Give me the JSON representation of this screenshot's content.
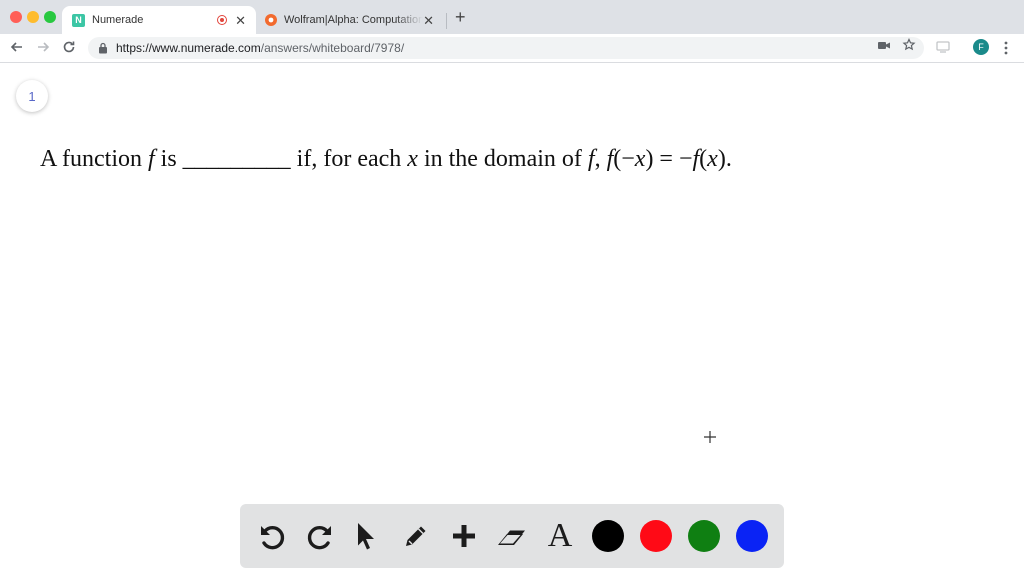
{
  "browser": {
    "tabs": [
      {
        "title": "Numerade",
        "favicon": "numerade-favicon",
        "active": true
      },
      {
        "title": "Wolfram|Alpha: Computational",
        "favicon": "wolfram-favicon",
        "active": false
      }
    ],
    "url": {
      "host": "https://www.numerade.com",
      "path": "/answers/whiteboard/7978/"
    },
    "profile_initial": "F"
  },
  "whiteboard": {
    "page_number": "1",
    "problem": {
      "part1": "A function ",
      "f1": "f",
      "part2": " is _________ if, for each ",
      "x1": "x",
      "part3": " in the domain of ",
      "f2": "f",
      "part4": ", ",
      "f3": "f",
      "part5": "(−",
      "x2": "x",
      "part6": ") = −",
      "f4": "f",
      "part7": "(",
      "x3": "x",
      "part8": ")."
    }
  },
  "tools": {
    "text_tool_label": "A",
    "colors": [
      "#000000",
      "#ff0a16",
      "#0f7f12",
      "#0a23f5"
    ]
  }
}
